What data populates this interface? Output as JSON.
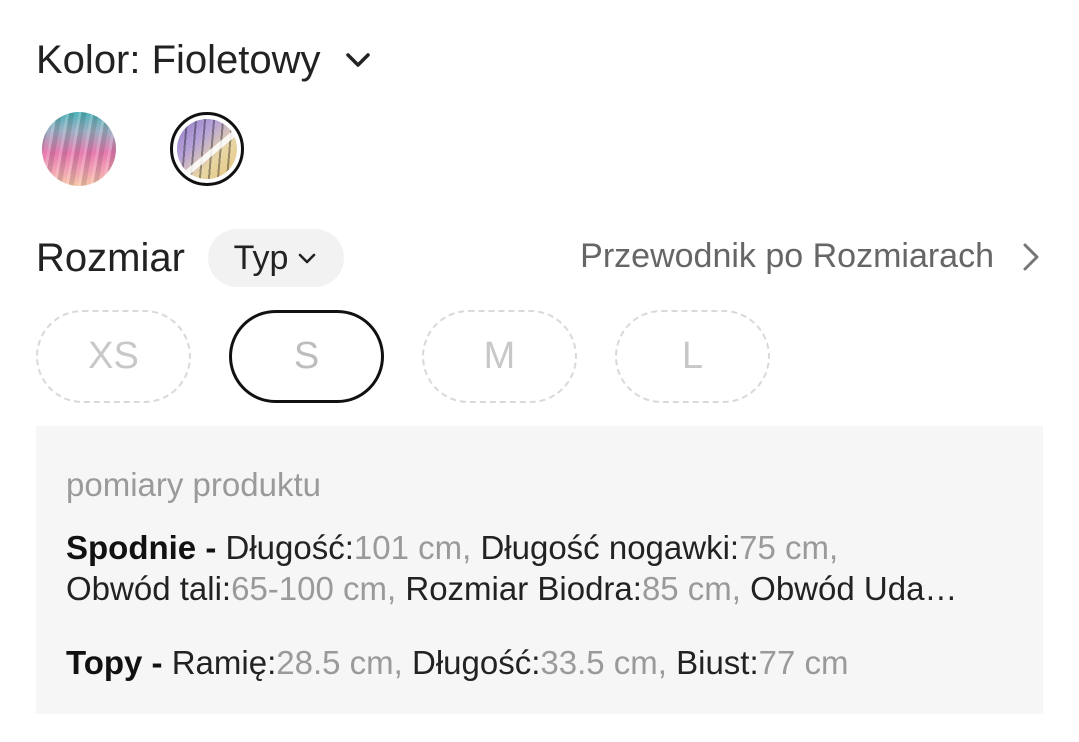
{
  "color": {
    "title": "Kolor: Fioletowy",
    "swatches": [
      {
        "name": "multicolor-pink-teal",
        "selected": false
      },
      {
        "name": "violet-gold",
        "selected": true
      }
    ]
  },
  "size": {
    "title": "Rozmiar",
    "type_label": "Typ",
    "guide_label": "Przewodnik po Rozmiarach",
    "options": [
      {
        "label": "XS",
        "selected": false,
        "available": false
      },
      {
        "label": "S",
        "selected": true,
        "available": false
      },
      {
        "label": "M",
        "selected": false,
        "available": false
      },
      {
        "label": "L",
        "selected": false,
        "available": false
      }
    ]
  },
  "measurements": {
    "title": "pomiary produktu",
    "groups": [
      {
        "name": "Spodnie -",
        "line1": [
          {
            "label": "Długość:",
            "value": "101 cm,"
          },
          {
            "label": "Długość nogawki:",
            "value": "75 cm,"
          }
        ],
        "line2": [
          {
            "label": "Obwód tali:",
            "value": "65-100 cm,"
          },
          {
            "label": "Rozmiar Biodra:",
            "value": "85 cm,"
          },
          {
            "label": "Obwód Uda…",
            "value": ""
          }
        ]
      },
      {
        "name": "Topy -",
        "line1": [
          {
            "label": "Ramię:",
            "value": "28.5 cm,"
          },
          {
            "label": "Długość:",
            "value": "33.5 cm,"
          },
          {
            "label": "Biust:",
            "value": "77 cm"
          }
        ]
      }
    ]
  }
}
